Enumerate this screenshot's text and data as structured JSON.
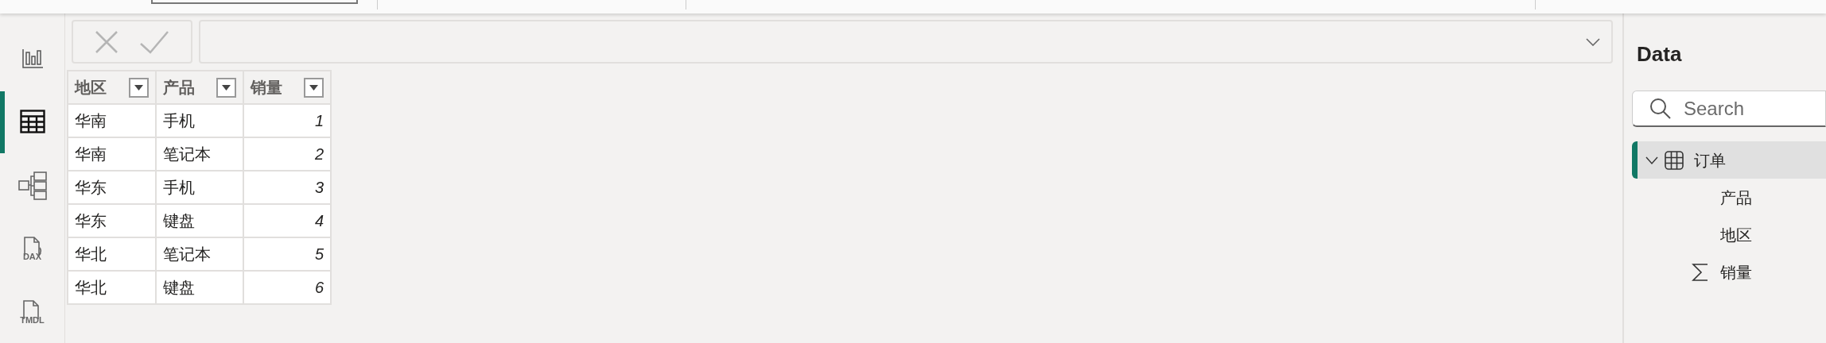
{
  "nav": [
    {
      "kind": "report",
      "selected": false
    },
    {
      "kind": "table",
      "selected": true
    },
    {
      "kind": "model",
      "selected": false
    },
    {
      "kind": "dax",
      "label": "DAX",
      "selected": false
    },
    {
      "kind": "tmdl",
      "label": "TMDL",
      "selected": false
    }
  ],
  "table": {
    "columns": [
      {
        "label": "地区",
        "kind": "text"
      },
      {
        "label": "产品",
        "kind": "text"
      },
      {
        "label": "销量",
        "kind": "number"
      }
    ],
    "rows": [
      [
        "华南",
        "手机",
        "1"
      ],
      [
        "华南",
        "笔记本",
        "2"
      ],
      [
        "华东",
        "手机",
        "3"
      ],
      [
        "华东",
        "键盘",
        "4"
      ],
      [
        "华北",
        "笔记本",
        "5"
      ],
      [
        "华北",
        "键盘",
        "6"
      ]
    ]
  },
  "data_pane": {
    "title": "Data",
    "search": {
      "placeholder": "Search"
    },
    "tree": [
      {
        "label": "订单",
        "expanded": true,
        "selected": true,
        "children": [
          {
            "label": "产品",
            "kind": "text"
          },
          {
            "label": "地区",
            "kind": "text"
          },
          {
            "label": "销量",
            "kind": "sum"
          }
        ]
      }
    ]
  }
}
